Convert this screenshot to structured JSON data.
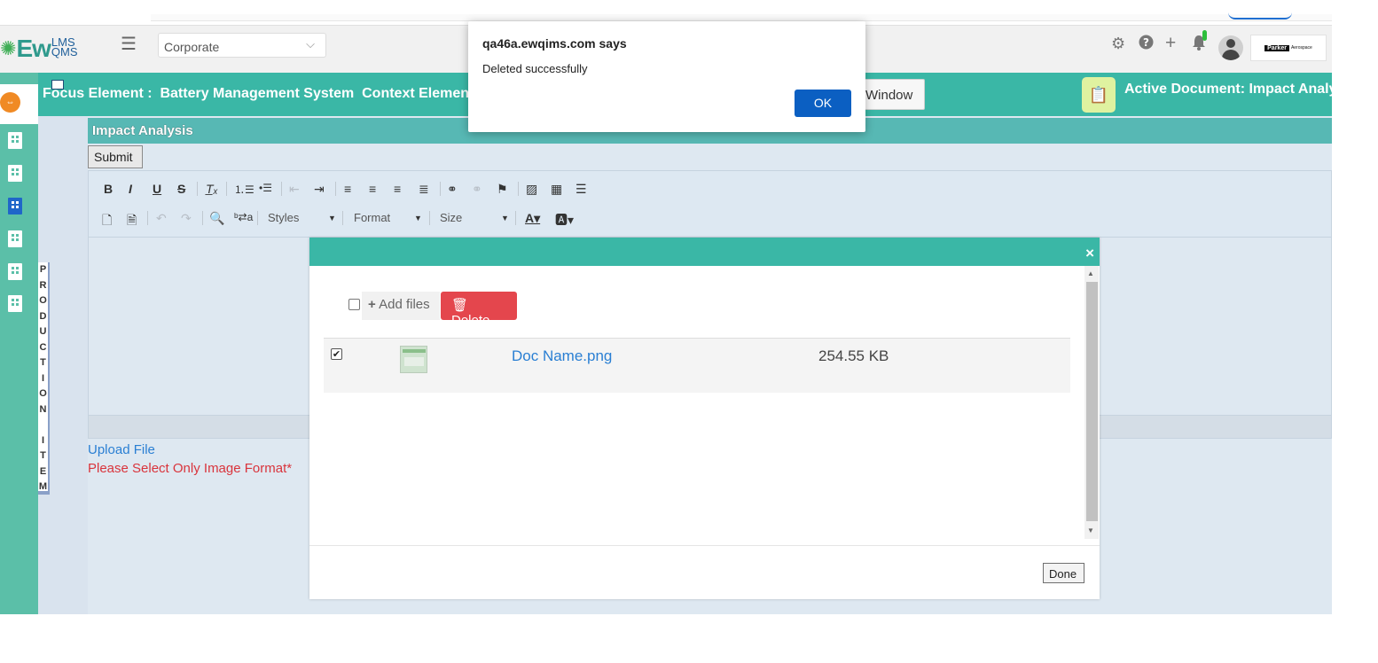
{
  "header": {
    "logo": {
      "ew": "Ew",
      "lms": "LMS",
      "qms": "QMS"
    },
    "company_select": {
      "value": "Corporate"
    },
    "icons": [
      "gear-icon",
      "help-icon",
      "plus-icon",
      "bell-icon"
    ],
    "brand": {
      "main": "Parker",
      "sub": "Aerospace"
    }
  },
  "context_bar": {
    "focus_label": "Focus Element :",
    "focus_value": "Battery Management System",
    "context_label": "Context Element",
    "window_button": "Window",
    "active_document": "Active Document: Impact Analy"
  },
  "sidebar": {
    "vertical_label": [
      "P",
      "R",
      "O",
      "D",
      "U",
      "C",
      "T",
      "I",
      "O",
      "N",
      " ",
      "I",
      "T",
      "E",
      "M"
    ]
  },
  "editor": {
    "section_title": "Impact Analysis",
    "submit_label": "Submit",
    "styles_label": "Styles",
    "format_label": "Format",
    "size_label": "Size",
    "upload_link": "Upload File",
    "image_note": "Please Select Only Image Format*"
  },
  "upload_modal": {
    "close_icon": "×",
    "add_files_label": "Add files",
    "delete_label": "Delete",
    "files": [
      {
        "name": "Doc Name.png",
        "size": "254.55 KB",
        "checked": true
      }
    ],
    "done_label": "Done"
  },
  "alert": {
    "title": "qa46a.ewqims.com says",
    "message": "Deleted successfully",
    "ok_label": "OK"
  },
  "colors": {
    "teal": "#3ab7a6",
    "sidebar": "#5bbfa8",
    "delete": "#e4464d",
    "link": "#2a7fd3",
    "alert_ok": "#0b5fc2"
  }
}
